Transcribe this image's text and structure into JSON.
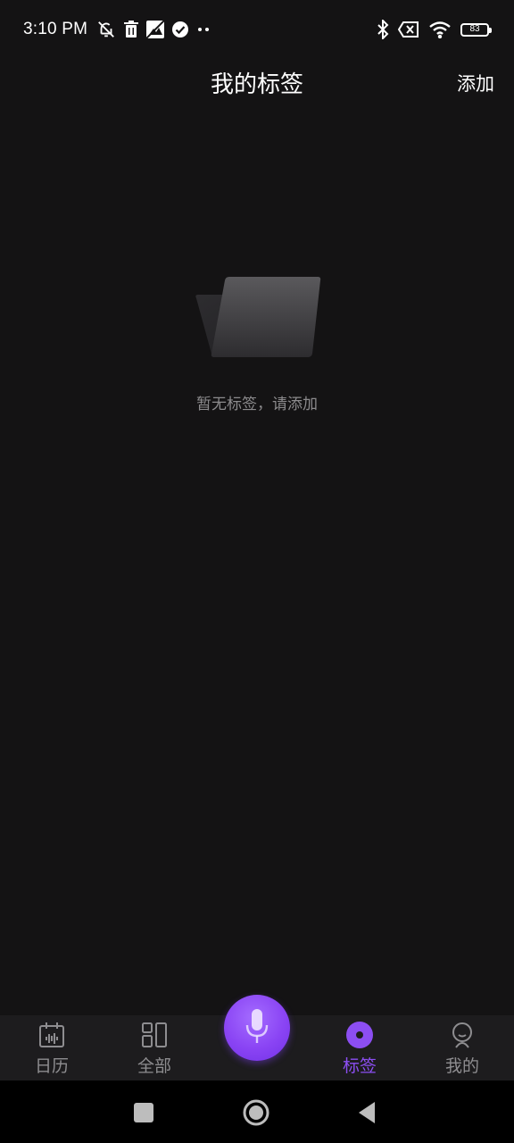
{
  "status_bar": {
    "time": "3:10 PM",
    "left_icons": [
      "bell-off-icon",
      "trash-icon",
      "image-icon",
      "check-circle-icon",
      "more-dots-icon"
    ],
    "right_icons": [
      "bluetooth-icon",
      "no-sim-icon",
      "wifi-icon"
    ],
    "battery_level": "83"
  },
  "header": {
    "title": "我的标签",
    "add_label": "添加"
  },
  "empty_state": {
    "icon": "folder-icon",
    "message": "暂无标签，请添加"
  },
  "tab_bar": {
    "items": [
      {
        "label": "日历",
        "icon": "calendar-icon"
      },
      {
        "label": "全部",
        "icon": "grid-icon"
      },
      {
        "label": "标签",
        "icon": "tag-dot-icon",
        "active": true
      },
      {
        "label": "我的",
        "icon": "profile-icon"
      }
    ],
    "center_button_icon": "microphone-icon",
    "active_color": "#8c4ef2"
  },
  "nav_bar": {
    "buttons": [
      "recent-apps-icon",
      "home-icon",
      "back-icon"
    ]
  },
  "colors": {
    "background": "#141314",
    "tab_bar_bg": "#1d1c1e",
    "accent": "#8c4ef2",
    "muted_text": "#8c8b8d"
  }
}
